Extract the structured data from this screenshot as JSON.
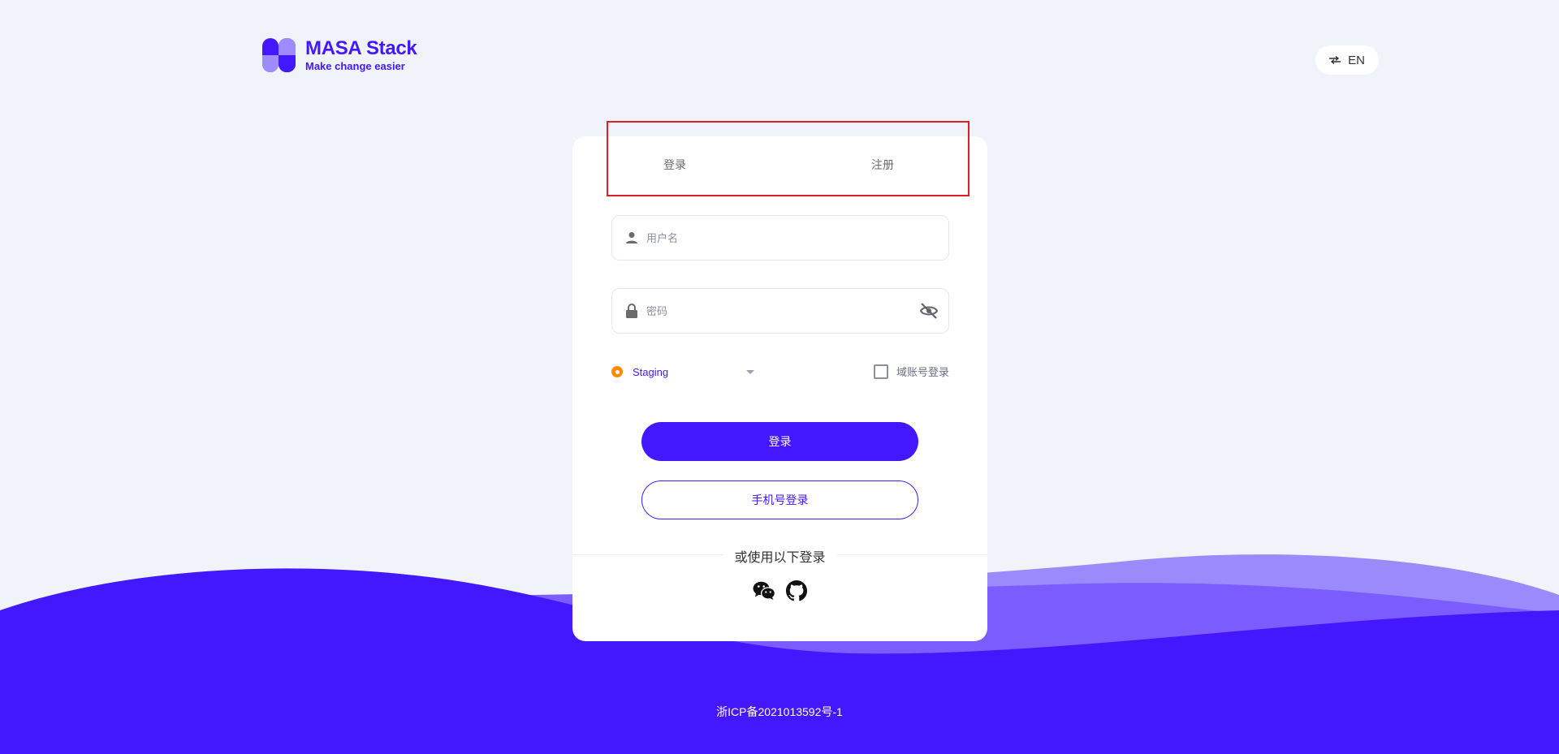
{
  "brand": {
    "title": "MASA Stack",
    "tagline": "Make change easier",
    "primary_color": "#4318ff",
    "secondary_color": "#9e8cff"
  },
  "language_toggle": {
    "label": "EN",
    "icon": "swap-arrows-icon"
  },
  "tabs": [
    {
      "label": "登录"
    },
    {
      "label": "注册"
    }
  ],
  "form": {
    "username": {
      "placeholder": "用户名",
      "value": "",
      "icon": "user-icon"
    },
    "password": {
      "placeholder": "密码",
      "value": "",
      "icon": "lock-icon",
      "toggle_icon": "eye-off-icon"
    },
    "environment": {
      "selected": "Staging",
      "status_color": "#ff8a00"
    },
    "domain_login": {
      "label": "域账号登录",
      "checked": false
    },
    "login_button": "登录",
    "phone_login_button": "手机号登录"
  },
  "alt_login": {
    "label": "或使用以下登录",
    "providers": [
      {
        "name": "wechat-icon"
      },
      {
        "name": "github-icon"
      }
    ]
  },
  "footer": {
    "icp": "浙ICP备2021013592号-1"
  }
}
